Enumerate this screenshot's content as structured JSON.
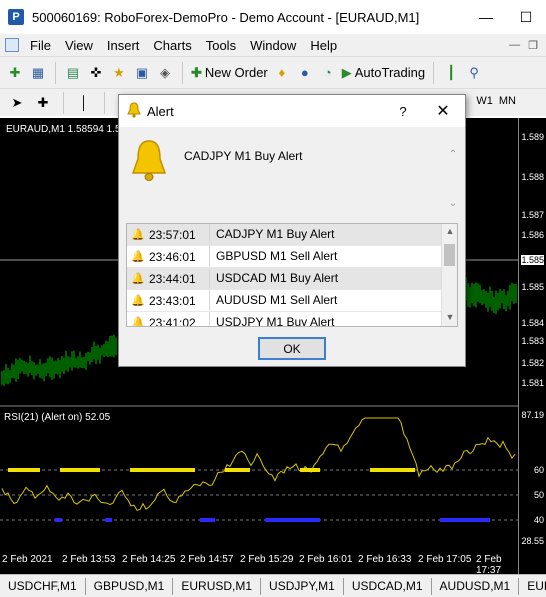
{
  "window": {
    "title": "500060169: RoboForex-DemoPro - Demo Account - [EURAUD,M1]",
    "app_icon": "metatrader-icon"
  },
  "menu": {
    "items": [
      "File",
      "View",
      "Insert",
      "Charts",
      "Tools",
      "Window",
      "Help"
    ]
  },
  "toolbar": {
    "new_order": "New Order",
    "autotrading": "AutoTrading"
  },
  "timeframes": [
    "W1",
    "MN"
  ],
  "chart": {
    "label": "EURAUD,M1  1.58594  1.5",
    "rsi_label": "RSI(21) (Alert on) 52.05",
    "price_ticks": [
      "1.589",
      "1.588",
      "1.587",
      "1.586",
      "1.585",
      "1.585",
      "1.584",
      "1.583",
      "1.582",
      "1.581"
    ],
    "rsi_ticks": [
      "87.19",
      "60",
      "50",
      "40",
      "28.55"
    ],
    "time_labels": [
      "2 Feb 2021",
      "2 Feb 13:53",
      "2 Feb 14:25",
      "2 Feb 14:57",
      "2 Feb 15:29",
      "2 Feb 16:01",
      "2 Feb 16:33",
      "2 Feb 17:05",
      "2 Feb 17:37"
    ],
    "colors": {
      "background": "#000000",
      "candles": "#00c000",
      "rsi_line": "#e6d200",
      "rsi_overbought": "#f2e000",
      "rsi_oversold": "#1a1aff"
    }
  },
  "symbol_tabs": [
    "USDCHF,M1",
    "GBPUSD,M1",
    "EURUSD,M1",
    "USDJPY,M1",
    "USDCAD,M1",
    "AUDUSD,M1",
    "EURGB"
  ],
  "dialog": {
    "title": "Alert",
    "help": "?",
    "message": "CADJPY M1 Buy Alert",
    "ok_label": "OK",
    "alerts": [
      {
        "time": "23:57:01",
        "message": "CADJPY M1 Buy Alert"
      },
      {
        "time": "23:46:01",
        "message": "GBPUSD M1 Sell Alert"
      },
      {
        "time": "23:44:01",
        "message": "USDCAD M1 Buy Alert"
      },
      {
        "time": "23:43:01",
        "message": "AUDUSD M1 Sell Alert"
      },
      {
        "time": "23:41:02",
        "message": "USDJPY M1 Buy Alert"
      }
    ]
  }
}
